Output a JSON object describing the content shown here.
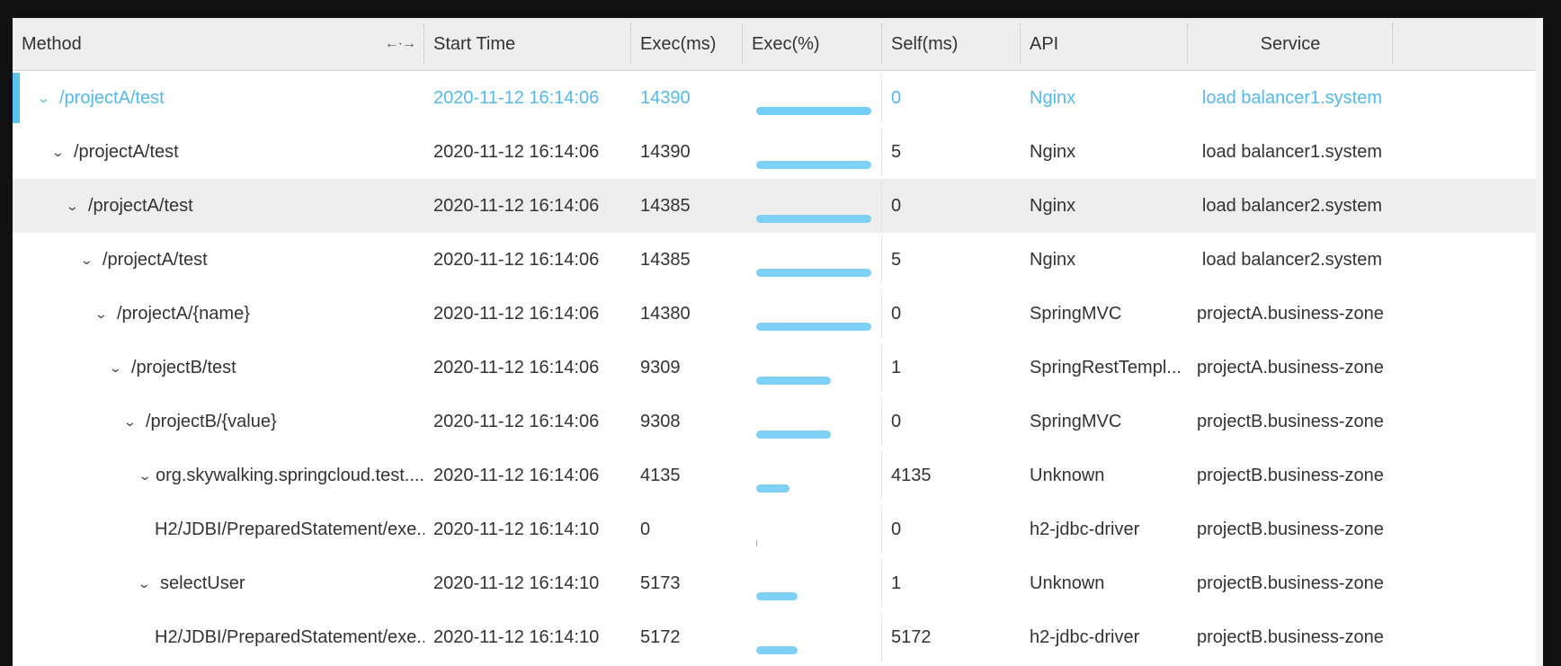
{
  "columns": {
    "method": "Method",
    "start_time": "Start Time",
    "exec_ms": "Exec(ms)",
    "exec_pct": "Exec(%)",
    "self_ms": "Self(ms)",
    "api": "API",
    "service": "Service"
  },
  "icons": {
    "expand": "chevron-down-icon",
    "resize": "column-resize-icon"
  },
  "colors": {
    "accent": "#55b9ea",
    "bar": "#7ed0f4",
    "hover_row": "#eeeeee",
    "header_bg": "#eeeeee"
  },
  "rows": [
    {
      "method": "/projectA/test",
      "start_time": "2020-11-12 16:14:06",
      "exec_ms": "14390",
      "exec_pct": 1.0,
      "self_ms": "0",
      "api": "Nginx",
      "service": "load balancer1.system",
      "depth": 0,
      "expandable": true,
      "selected": true
    },
    {
      "method": "/projectA/test",
      "start_time": "2020-11-12 16:14:06",
      "exec_ms": "14390",
      "exec_pct": 1.0,
      "self_ms": "5",
      "api": "Nginx",
      "service": "load balancer1.system",
      "depth": 1,
      "expandable": true
    },
    {
      "method": "/projectA/test",
      "start_time": "2020-11-12 16:14:06",
      "exec_ms": "14385",
      "exec_pct": 1.0,
      "self_ms": "0",
      "api": "Nginx",
      "service": "load balancer2.system",
      "depth": 2,
      "expandable": true,
      "hover": true
    },
    {
      "method": "/projectA/test",
      "start_time": "2020-11-12 16:14:06",
      "exec_ms": "14385",
      "exec_pct": 1.0,
      "self_ms": "5",
      "api": "Nginx",
      "service": "load balancer2.system",
      "depth": 3,
      "expandable": true
    },
    {
      "method": "/projectA/{name}",
      "start_time": "2020-11-12 16:14:06",
      "exec_ms": "14380",
      "exec_pct": 1.0,
      "self_ms": "0",
      "api": "SpringMVC",
      "service": "projectA.business-zone",
      "depth": 4,
      "expandable": true
    },
    {
      "method": "/projectB/test",
      "start_time": "2020-11-12 16:14:06",
      "exec_ms": "9309",
      "exec_pct": 0.65,
      "self_ms": "1",
      "api": "SpringRestTempl...",
      "service": "projectA.business-zone",
      "depth": 5,
      "expandable": true
    },
    {
      "method": "/projectB/{value}",
      "start_time": "2020-11-12 16:14:06",
      "exec_ms": "9308",
      "exec_pct": 0.65,
      "self_ms": "0",
      "api": "SpringMVC",
      "service": "projectB.business-zone",
      "depth": 6,
      "expandable": true
    },
    {
      "method": "org.skywalking.springcloud.test....",
      "start_time": "2020-11-12 16:14:06",
      "exec_ms": "4135",
      "exec_pct": 0.29,
      "self_ms": "4135",
      "api": "Unknown",
      "service": "projectB.business-zone",
      "depth": 7,
      "expandable": true
    },
    {
      "method": "H2/JDBI/PreparedStatement/exe...",
      "start_time": "2020-11-12 16:14:10",
      "exec_ms": "0",
      "exec_pct": 0.0,
      "self_ms": "0",
      "api": "h2-jdbc-driver",
      "service": "projectB.business-zone",
      "depth": 8,
      "expandable": false
    },
    {
      "method": "selectUser",
      "start_time": "2020-11-12 16:14:10",
      "exec_ms": "5173",
      "exec_pct": 0.36,
      "self_ms": "1",
      "api": "Unknown",
      "service": "projectB.business-zone",
      "depth": 7,
      "expandable": true
    },
    {
      "method": "H2/JDBI/PreparedStatement/exe...",
      "start_time": "2020-11-12 16:14:10",
      "exec_ms": "5172",
      "exec_pct": 0.36,
      "self_ms": "5172",
      "api": "h2-jdbc-driver",
      "service": "projectB.business-zone",
      "depth": 8,
      "expandable": false
    }
  ]
}
